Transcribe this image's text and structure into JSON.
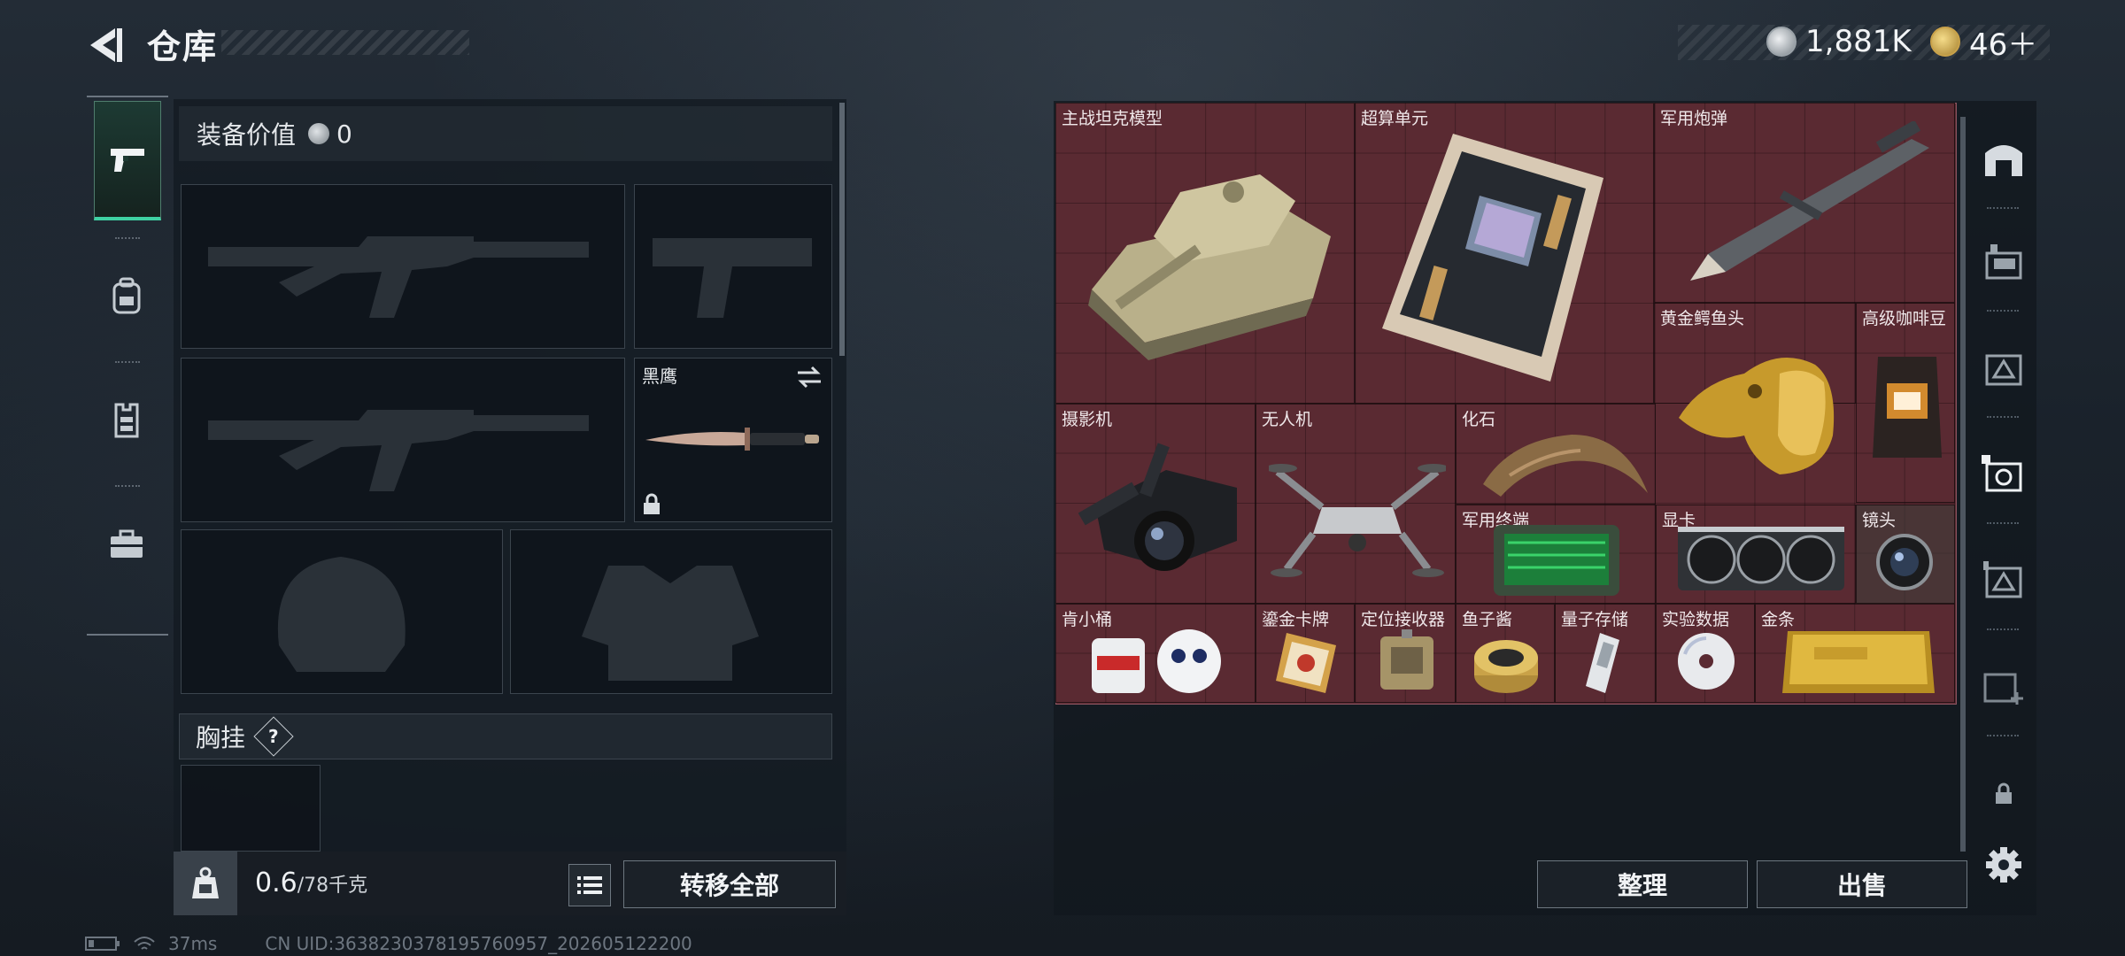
{
  "header": {
    "title": "仓库",
    "back_icon": "back-arrow-icon",
    "currency": [
      {
        "icon": "silver-coin-icon",
        "value": "1,881K"
      },
      {
        "icon": "gold-token-icon",
        "value": "46＋"
      }
    ]
  },
  "left_tabs": [
    {
      "icon": "pistol-icon",
      "active": true
    },
    {
      "icon": "backpack-icon",
      "active": false
    },
    {
      "icon": "vest-icon",
      "active": false
    },
    {
      "icon": "briefcase-icon",
      "active": false
    }
  ],
  "equipment": {
    "value_label": "装备价值",
    "value": "0",
    "slots": [
      {
        "name": "primary-weapon-slot",
        "content": "rifle-silhouette"
      },
      {
        "name": "pistol-slot",
        "content": "pistol-silhouette"
      },
      {
        "name": "secondary-weapon-slot",
        "content": "rifle-silhouette"
      },
      {
        "name": "melee-slot",
        "label": "黑鹰",
        "content": "knife",
        "locked": true,
        "swap_icon": "swap-icon"
      },
      {
        "name": "helmet-slot",
        "content": "helmet-silhouette"
      },
      {
        "name": "armor-slot",
        "content": "armor-silhouette"
      }
    ],
    "chest_label": "胸挂",
    "chest_help": "?"
  },
  "weight": {
    "current": "0.6",
    "max": "/78千克"
  },
  "buttons": {
    "transfer_all": "转移全部",
    "sort": "整理",
    "sell": "出售"
  },
  "items": [
    {
      "label": "主战坦克模型",
      "icon": "tank-model"
    },
    {
      "label": "超算单元",
      "icon": "supercomputer-board"
    },
    {
      "label": "军用炮弹",
      "icon": "missile"
    },
    {
      "label": "黄金鳄鱼头",
      "icon": "gold-crocodile-head"
    },
    {
      "label": "高级咖啡豆",
      "icon": "coffee-bag"
    },
    {
      "label": "摄影机",
      "icon": "video-camera"
    },
    {
      "label": "无人机",
      "icon": "drone"
    },
    {
      "label": "化石",
      "icon": "fossil-claw"
    },
    {
      "label": "军用终端",
      "icon": "military-terminal"
    },
    {
      "label": "显卡",
      "icon": "graphics-card"
    },
    {
      "label": "镜头",
      "icon": "camera-lens"
    },
    {
      "label": "肯小桶",
      "icon": "bucket-figure"
    },
    {
      "label": "鎏金卡牌",
      "icon": "gold-card"
    },
    {
      "label": "定位接收器",
      "icon": "gps-receiver"
    },
    {
      "label": "鱼子酱",
      "icon": "caviar-tin"
    },
    {
      "label": "量子存储",
      "icon": "quantum-storage"
    },
    {
      "label": "实验数据",
      "icon": "data-disc"
    },
    {
      "label": "金条",
      "icon": "gold-bar"
    }
  ],
  "right_icons": [
    "stash-home-icon",
    "storage-1-icon",
    "storage-2-icon",
    "storage-4-icon",
    "storage-3-icon",
    "add-storage-icon",
    "lock-icon",
    "settings-gear-icon"
  ],
  "status": {
    "ping": "37ms",
    "uid": "CN UID:3638230378195760957_202605122200"
  },
  "colors": {
    "grid_bg": "#5a2a32",
    "active_tab": "#3fd1a3",
    "panel": "#141b22"
  }
}
